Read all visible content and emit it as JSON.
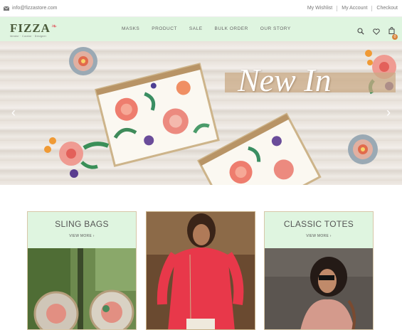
{
  "topbar": {
    "email": "info@fizzastore.com",
    "links": [
      "My Wishlist",
      "My Account",
      "Checkout"
    ]
  },
  "brand": {
    "name": "FIZZA",
    "tagline": "Ideator · Curator · Designer"
  },
  "nav": {
    "items": [
      "MASKS",
      "PRODUCT",
      "SALE",
      "BULK ORDER",
      "OUR STORY"
    ],
    "cart_count": "0"
  },
  "hero": {
    "title": "New In"
  },
  "cards": [
    {
      "title": "SLING BAGS",
      "cta": "VIEW MORE"
    },
    {
      "title": "",
      "cta": ""
    },
    {
      "title": "CLASSIC TOTES",
      "cta": "VIEW MORE"
    }
  ],
  "colors": {
    "nav_bg": "#dff5e0",
    "accent": "#d8863e",
    "card_border": "#d7c7a8"
  },
  "icons": [
    "mail-icon",
    "search-icon",
    "heart-icon",
    "cart-icon",
    "chevron-left-icon",
    "chevron-right-icon"
  ]
}
